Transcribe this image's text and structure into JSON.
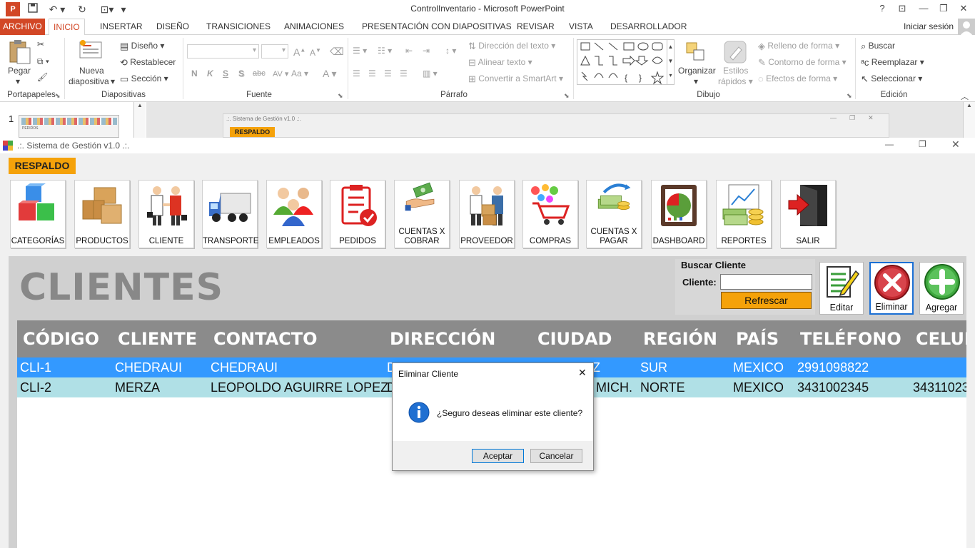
{
  "powerpoint": {
    "title": "ControlInventario - Microsoft PowerPoint",
    "signin": "Iniciar sesión",
    "tabs": [
      "ARCHIVO",
      "INICIO",
      "INSERTAR",
      "DISEÑO",
      "TRANSICIONES",
      "ANIMACIONES",
      "PRESENTACIÓN CON DIAPOSITIVAS",
      "REVISAR",
      "VISTA",
      "DESARROLLADOR"
    ],
    "ribbon": {
      "pegar": "Pegar",
      "nueva": "Nueva",
      "diapositiva": "diapositiva",
      "diseno": "Diseño",
      "restablecer": "Restablecer",
      "seccion": "Sección",
      "negrita": "N",
      "cursiva": "K",
      "subrayado": "S",
      "sombra": "S",
      "tachado": "abc",
      "espaciado": "AV",
      "mayus": "Aa",
      "color_fuente": "A",
      "aumentar": "A",
      "disminuir": "A",
      "direccion": "Dirección del texto",
      "alinear": "Alinear texto",
      "smartart": "Convertir a SmartArt",
      "organizar": "Organizar",
      "estilos1": "Estilos",
      "estilos2": "rápidos",
      "relleno": "Relleno de forma",
      "contorno": "Contorno de forma",
      "efectos": "Efectos de forma",
      "buscar": "Buscar",
      "reemplazar": "Reemplazar",
      "seleccionar": "Seleccionar",
      "groups": [
        "Portapapeles",
        "Diapositivas",
        "Fuente",
        "Párrafo",
        "Dibujo",
        "Edición"
      ]
    },
    "slide_number": "1",
    "thumb_text": "PEDIDOS",
    "preview_title": ".:. Sistema de Gestión v1.0 .:.",
    "preview_respaldo": "RESPALDO"
  },
  "app": {
    "title": ".:. Sistema de Gestión v1.0 .:.",
    "respaldo": "RESPALDO",
    "modules": [
      {
        "label": "CATEGORÍAS"
      },
      {
        "label": "PRODUCTOS"
      },
      {
        "label": "CLIENTE"
      },
      {
        "label": "TRANSPORTE"
      },
      {
        "label": "EMPLEADOS"
      },
      {
        "label": "PEDIDOS"
      },
      {
        "label": "CUENTAS X COBRAR"
      },
      {
        "label": "PROVEEDOR"
      },
      {
        "label": "COMPRAS"
      },
      {
        "label": "CUENTAS X PAGAR"
      },
      {
        "label": "DASHBOARD"
      },
      {
        "label": "REPORTES"
      },
      {
        "label": "SALIR"
      }
    ],
    "heading": "CLIENTES",
    "search": {
      "title": "Buscar Cliente",
      "label": "Cliente:",
      "value": "",
      "refresh": "Refrescar"
    },
    "actions": {
      "edit": "Editar",
      "delete": "Eliminar",
      "add": "Agregar"
    },
    "grid": {
      "headers": [
        "CÓDIGO",
        "CLIENTE",
        "CONTACTO",
        "DIRECCIÓN",
        "CIUDAD",
        "REGIÓN",
        "PAÍS",
        "TELÉFONO",
        "CELUL"
      ],
      "rows": [
        {
          "codigo": "CLI-1",
          "cliente": "CHEDRAUI",
          "contacto": "CHEDRAUI",
          "direccion": "D",
          "ciudad": "Z",
          "region": "SUR",
          "pais": "MEXICO",
          "telefono": "2991098822",
          "celular": ""
        },
        {
          "codigo": "CLI-2",
          "cliente": "MERZA",
          "contacto": "LEOPOLDO AGUIRRE LOPEZ",
          "direccion": "D",
          "ciudad": "MICH.",
          "region": "NORTE",
          "pais": "MEXICO",
          "telefono": "3431002345",
          "celular": "34311023"
        }
      ]
    }
  },
  "dialog": {
    "title": "Eliminar Cliente",
    "message": "¿Seguro deseas eliminar este cliente?",
    "ok": "Aceptar",
    "cancel": "Cancelar"
  },
  "colors": {
    "accent": "#d24726",
    "respaldo": "#f5a20a",
    "selected_row": "#3399ff",
    "alt_row": "#b0e0e6",
    "header": "#8b8b8b"
  }
}
